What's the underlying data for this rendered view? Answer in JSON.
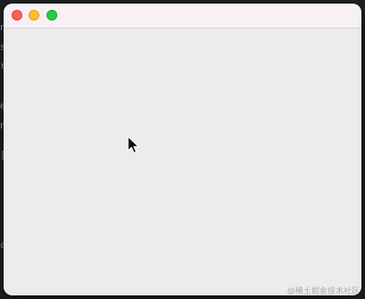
{
  "window": {
    "title": ""
  },
  "controls": {
    "close_color": "#fe5f57",
    "minimize_color": "#febc2e",
    "zoom_color": "#28c840"
  },
  "background_glyphs": [
    "n",
    "s",
    "r",
    "e",
    "n",
    "_",
    "[",
    "c"
  ],
  "cursor": {
    "icon": "arrow-pointer-icon"
  },
  "watermark": {
    "text": "@稀土掘金技术社区"
  }
}
